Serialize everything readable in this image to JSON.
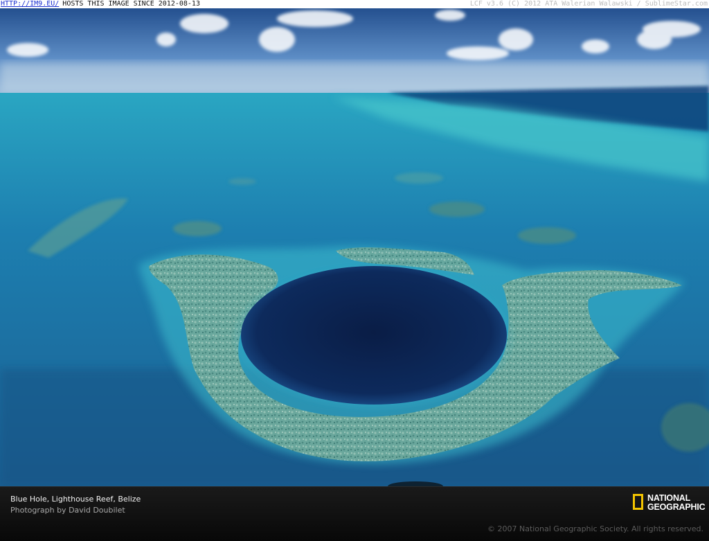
{
  "header": {
    "link_text": "HTTP://IM9.EU/",
    "host_text": "HOSTS THIS IMAGE SINCE 2012-08-13",
    "credit_text": "LCF v3.6 (C) 2012 ATA Walerian Walawski / SublimeStar.com"
  },
  "caption": {
    "title": "Blue Hole, Lighthouse Reef, Belize",
    "photographer": "Photograph by David Doubilet",
    "copyright": "© 2007 National Geographic Society. All rights reserved."
  },
  "logo": {
    "line1": "NATIONAL",
    "line2": "GEOGRAPHIC",
    "frame_color": "#f3c400"
  },
  "photo": {
    "subject": "blue-hole-reef-aerial",
    "colors": {
      "sky_top": "#1f4f8f",
      "ocean": "#1a6fa3",
      "shallow": "#2bb5c7",
      "hole": "#0c2452",
      "reef": "#6fa89a"
    }
  }
}
